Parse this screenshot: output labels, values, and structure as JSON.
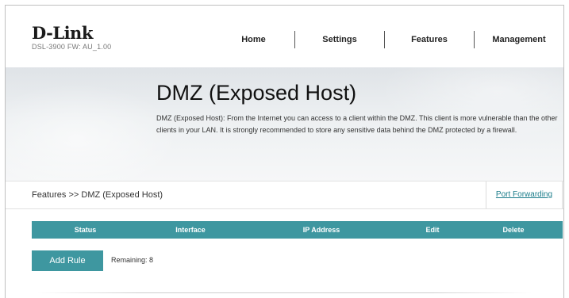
{
  "header": {
    "logo_text": "D-Link",
    "model_text": "DSL-3900  FW: AU_1.00",
    "nav": [
      {
        "label": "Home"
      },
      {
        "label": "Settings"
      },
      {
        "label": "Features"
      },
      {
        "label": "Management"
      }
    ]
  },
  "hero": {
    "title": "DMZ (Exposed Host)",
    "description": "DMZ (Exposed Host): From the Internet you can access to a client within the DMZ. This client is more vulnerable than the other clients in your LAN. It is strongly recommended to store any sensitive data behind the DMZ protected by a firewall."
  },
  "breadcrumb": {
    "text": "Features >> DMZ (Exposed Host)",
    "link_label": "Port Forwarding"
  },
  "table": {
    "columns": [
      "Status",
      "Interface",
      "IP Address",
      "Edit",
      "Delete"
    ],
    "rows": []
  },
  "actions": {
    "add_rule_label": "Add Rule",
    "remaining_text": "Remaining: 8"
  },
  "colors": {
    "accent": "#3e97a0",
    "link": "#1a7c8a"
  }
}
